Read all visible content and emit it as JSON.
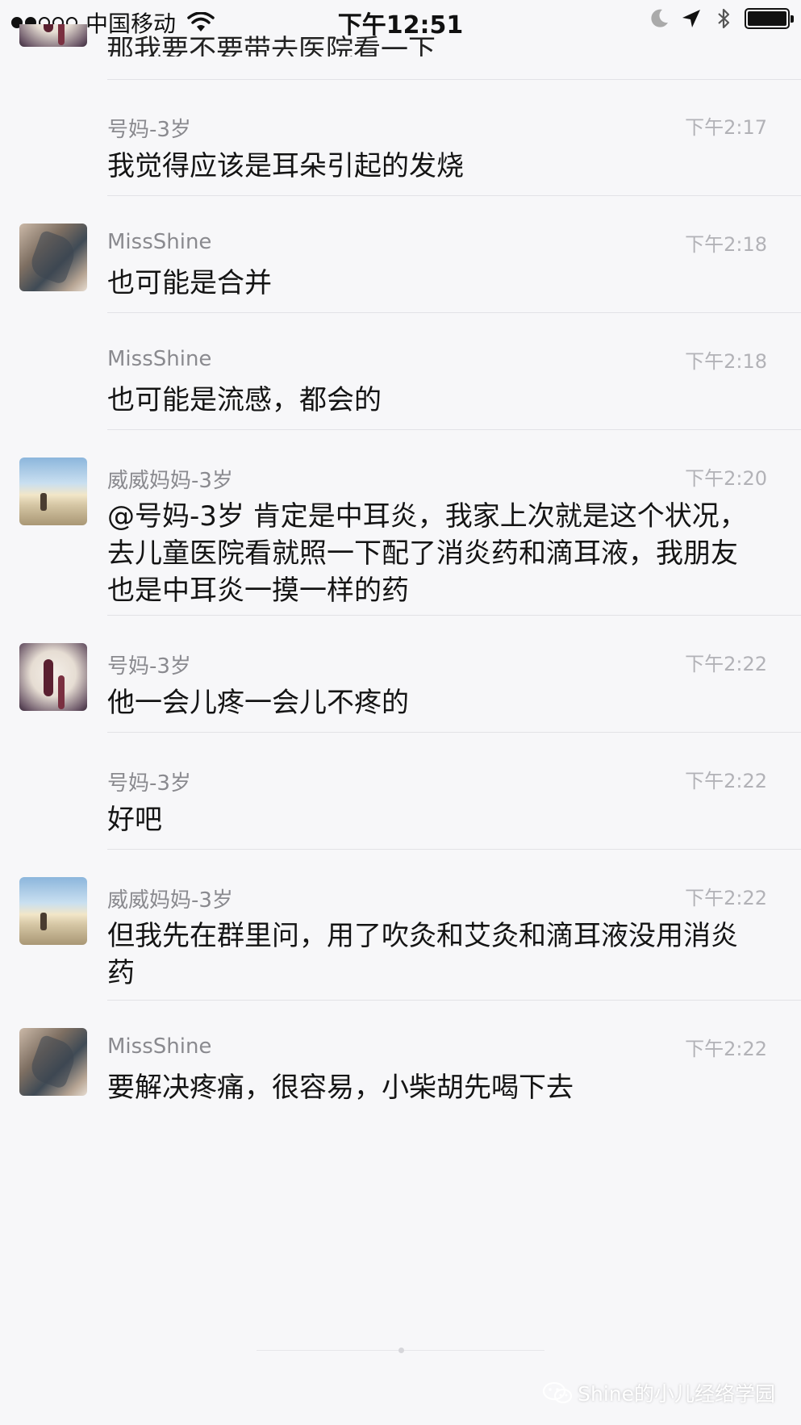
{
  "status_bar": {
    "carrier": "中国移动",
    "time": "下午12:51",
    "icons": [
      "signal-dots-icon",
      "wifi-icon",
      "moon-icon",
      "location-arrow-icon",
      "bluetooth-icon",
      "battery-icon"
    ]
  },
  "partial_message": {
    "text": "那我要不要带去医院看一下"
  },
  "messages": [
    {
      "name": "号妈-3岁",
      "time": "下午2:17",
      "text": "我觉得应该是耳朵引起的发烧",
      "avatar": "none"
    },
    {
      "name": "MissShine",
      "time": "下午2:18",
      "text": "也可能是合并",
      "avatar": "missshine-avatar"
    },
    {
      "name": "MissShine",
      "time": "下午2:18",
      "text": "也可能是流感，都会的",
      "avatar": "none"
    },
    {
      "name": "威威妈妈-3岁",
      "time": "下午2:20",
      "text": "@号妈-3岁 肯定是中耳炎，我家上次就是这个状况，去儿童医院看就照一下配了消炎药和滴耳液，我朋友也是中耳炎一摸一样的药",
      "avatar": "beach-avatar"
    },
    {
      "name": "号妈-3岁",
      "time": "下午2:22",
      "text": "他一会儿疼一会儿不疼的",
      "avatar": "mother-child-avatar"
    },
    {
      "name": "号妈-3岁",
      "time": "下午2:22",
      "text": "好吧",
      "avatar": "none"
    },
    {
      "name": "威威妈妈-3岁",
      "time": "下午2:22",
      "text": "但我先在群里问，用了吹灸和艾灸和滴耳液没用消炎药",
      "avatar": "beach-avatar"
    },
    {
      "name": "MissShine",
      "time": "下午2:22",
      "text": "要解决疼痛，很容易，小柴胡先喝下去",
      "avatar": "missshine-avatar"
    }
  ],
  "watermark": {
    "text": "Shine的小儿经络学园",
    "icon": "wechat-icon"
  }
}
